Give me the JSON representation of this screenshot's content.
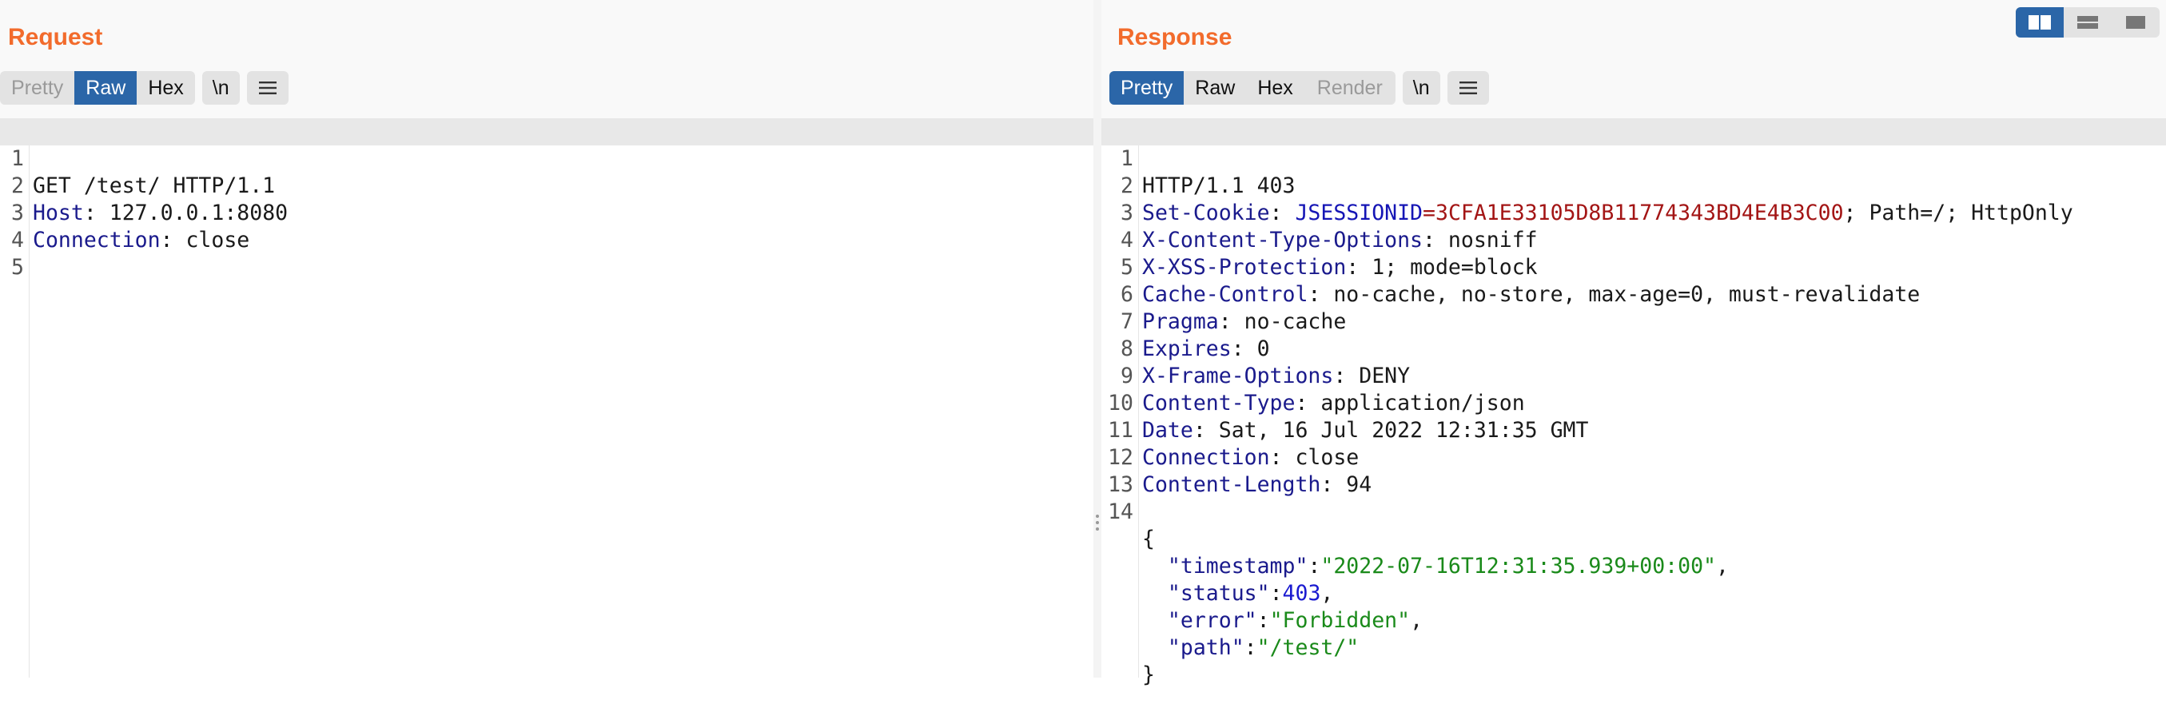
{
  "request": {
    "title": "Request",
    "tabs": [
      "Pretty",
      "Raw",
      "Hex"
    ],
    "selected_tab": "Raw",
    "newline_label": "\\n",
    "lines": [
      {
        "n": "1",
        "text": "GET /test/ HTTP/1.1"
      },
      {
        "n": "2",
        "name": "Host",
        "value": " 127.0.0.1:8080"
      },
      {
        "n": "3",
        "name": "Connection",
        "value": " close"
      },
      {
        "n": "4",
        "text": ""
      },
      {
        "n": "5",
        "text": ""
      }
    ]
  },
  "response": {
    "title": "Response",
    "tabs": [
      "Pretty",
      "Raw",
      "Hex",
      "Render"
    ],
    "selected_tab": "Pretty",
    "disabled_tab": "Render",
    "newline_label": "\\n",
    "lines": [
      {
        "n": "1",
        "text": "HTTP/1.1 403"
      },
      {
        "n": "2",
        "name": "Set-Cookie",
        "cookie_name": "JSESSIONID",
        "cookie_value": "3CFA1E33105D8B11774343BD4E4B3C00",
        "rest": "; Path=/; HttpOnly"
      },
      {
        "n": "3",
        "name": "X-Content-Type-Options",
        "value": " nosniff"
      },
      {
        "n": "4",
        "name": "X-XSS-Protection",
        "value": " 1; mode=block"
      },
      {
        "n": "5",
        "name": "Cache-Control",
        "value": " no-cache, no-store, max-age=0, must-revalidate"
      },
      {
        "n": "6",
        "name": "Pragma",
        "value": " no-cache"
      },
      {
        "n": "7",
        "name": "Expires",
        "value": " 0"
      },
      {
        "n": "8",
        "name": "X-Frame-Options",
        "value": " DENY"
      },
      {
        "n": "9",
        "name": "Content-Type",
        "value": " application/json"
      },
      {
        "n": "10",
        "name": "Date",
        "value": " Sat, 16 Jul 2022 12:31:35 GMT"
      },
      {
        "n": "11",
        "name": "Connection",
        "value": " close"
      },
      {
        "n": "12",
        "name": "Content-Length",
        "value": " 94"
      },
      {
        "n": "13",
        "text": ""
      },
      {
        "n": "14",
        "text": "{"
      },
      {
        "n": "",
        "indent": "  ",
        "key": "\"timestamp\"",
        "val": "\"2022-07-16T12:31:35.939+00:00\"",
        "val_type": "str",
        "trail": ","
      },
      {
        "n": "",
        "indent": "  ",
        "key": "\"status\"",
        "val": "403",
        "val_type": "num",
        "trail": ","
      },
      {
        "n": "",
        "indent": "  ",
        "key": "\"error\"",
        "val": "\"Forbidden\"",
        "val_type": "str",
        "trail": ","
      },
      {
        "n": "",
        "indent": "  ",
        "key": "\"path\"",
        "val": "\"/test/\"",
        "val_type": "str",
        "trail": ""
      },
      {
        "n": "",
        "text": "}"
      }
    ]
  },
  "layout_buttons": [
    {
      "name": "side-by-side-layout-icon",
      "selected": true
    },
    {
      "name": "top-bottom-layout-icon",
      "selected": false
    },
    {
      "name": "single-pane-layout-icon",
      "selected": false
    }
  ],
  "colors": {
    "accent_title": "#f26b2c",
    "selected_tab": "#2b66a8",
    "header_name": "#1a1a8c",
    "cookie_value": "#a31515",
    "json_string": "#1a8a1a",
    "json_number": "#1a1ad0"
  }
}
